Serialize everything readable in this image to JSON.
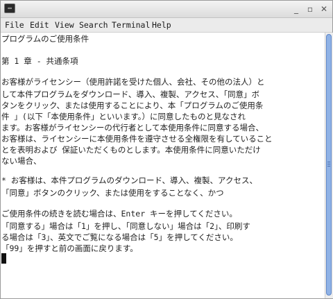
{
  "titlebar": {
    "terminal_icon_glyph": "▭",
    "minimize_glyph": "_",
    "maximize_glyph": "▫",
    "close_glyph": "✕"
  },
  "menu": [
    "File",
    "Edit",
    "View",
    "Search",
    "Terminal",
    "Help"
  ],
  "terminal": {
    "lines": [
      "プログラムのご使用条件",
      "",
      "第 1 章 - 共通条項",
      "",
      "お客様がライセンシー（使用許諾を受けた個人、会社、その他の法人）と",
      "して本件プログラムをダウンロード、導入、複製、アクセス、「同意」ボ",
      "タンをクリック、または使用することにより、本「プログラムのご使用条",
      "件 」(以下「本使用条件」といいます。）に同意したものと見なされ",
      "ます。お客様がライセンシーの代行者として本使用条件に同意する場合、",
      "お客様は、ライセンシーに本使用条件を遵守させる全権限を有していること",
      "とを表明および 保証いただくものとします。本使用条件に同意いただけ",
      "ない場合、",
      "",
      "* お客様は、本件プログラムのダウンロード、導入、複製、アクセス、",
      "「同意」ボタンのクリック、または使用をすることなく、かつ",
      "",
      "ご使用条件の続きを読む場合は、Enter キーを押してください。",
      "「同意する」場合は「1」を押し、「同意しない」場合は「2」、印刷す",
      "る場合は「3」、英文でご覧になる場合は「5」を押してください。",
      "「99」を押すと前の画面に戻ります。"
    ]
  },
  "colors": {
    "text": "#1f1f1f",
    "scroll_thumb": "#8fb2e6",
    "cursor": "#111111"
  }
}
